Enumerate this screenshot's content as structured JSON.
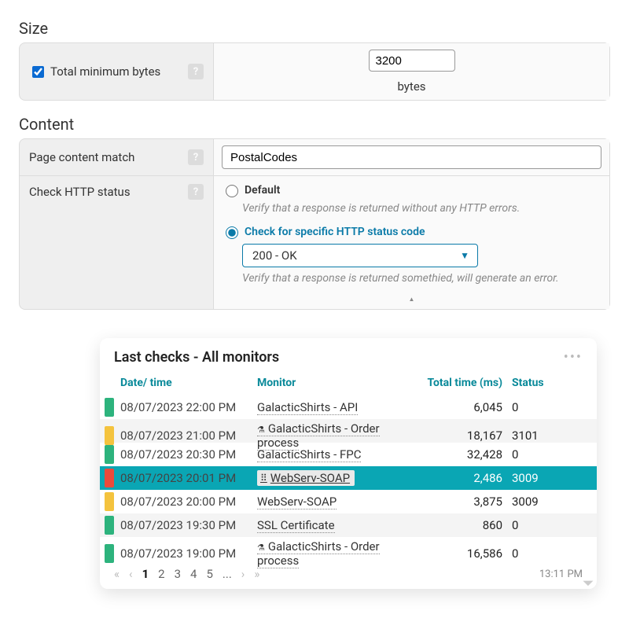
{
  "size": {
    "title": "Size",
    "checkbox_label": "Total minimum bytes",
    "checkbox_checked": true,
    "value": "3200",
    "unit": "bytes",
    "help": "?"
  },
  "content": {
    "title": "Content",
    "match_label": "Page content match",
    "match_value": "PostalCodes",
    "help": "?",
    "http_label": "Check HTTP status",
    "default": {
      "label": "Default",
      "help": "Verify that a response is returned without any HTTP errors."
    },
    "specific": {
      "label": "Check for specific HTTP status code",
      "selected": "200 - OK",
      "help": "Verify that a response is returned somethied, will generate an error."
    }
  },
  "card": {
    "title": "Last checks - All monitors",
    "columns": {
      "date": "Date/ time",
      "monitor": "Monitor",
      "time": "Total time (ms)",
      "status": "Status"
    },
    "rows": [
      {
        "color": "g",
        "date": "08/07/2023 22:00 PM",
        "monitor": "GalacticShirts - API",
        "time": "6,045",
        "status": "0",
        "flask": false,
        "sel": false
      },
      {
        "color": "y",
        "date": "08/07/2023 21:00 PM",
        "monitor": "GalacticShirts - Order process",
        "time": "18,167",
        "status": "3101",
        "flask": true,
        "sel": false
      },
      {
        "color": "g",
        "date": "08/07/2023 20:30 PM",
        "monitor": "GalacticShirts - FPC",
        "time": "32,428",
        "status": "0",
        "flask": false,
        "sel": false
      },
      {
        "color": "r",
        "date": "08/07/2023 20:01 PM",
        "monitor": "WebServ-SOAP",
        "time": "2,486",
        "status": "3009",
        "flask": false,
        "sel": true
      },
      {
        "color": "y",
        "date": "08/07/2023 20:00 PM",
        "monitor": "WebServ-SOAP",
        "time": "3,875",
        "status": "3009",
        "flask": false,
        "sel": false
      },
      {
        "color": "g",
        "date": "08/07/2023 19:30 PM",
        "monitor": "SSL Certificate",
        "time": "860",
        "status": "0",
        "flask": false,
        "sel": false
      },
      {
        "color": "g",
        "date": "08/07/2023 19:00 PM",
        "monitor": "GalacticShirts - Order process",
        "time": "16,586",
        "status": "0",
        "flask": true,
        "sel": false
      }
    ],
    "pages": [
      "1",
      "2",
      "3",
      "4",
      "5",
      "..."
    ],
    "clock": "13:11 PM"
  }
}
